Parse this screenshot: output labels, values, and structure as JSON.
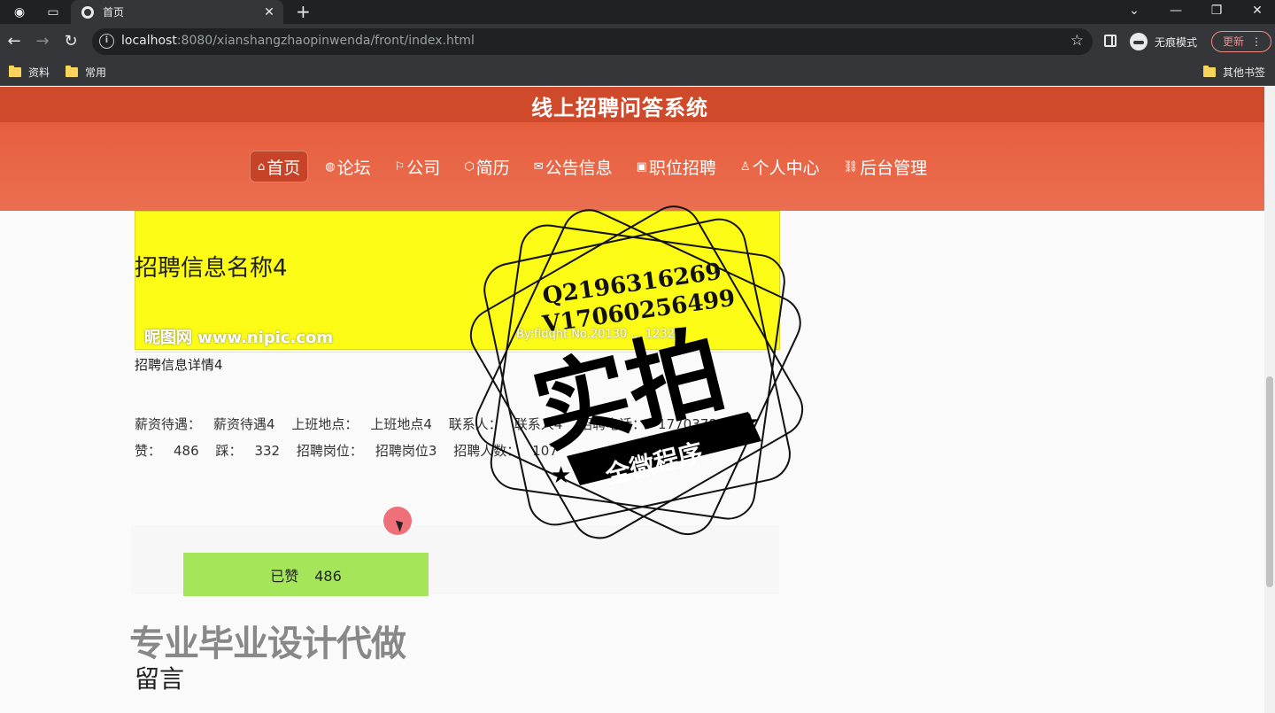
{
  "browser": {
    "tab_title": "首页",
    "url_host": "localhost",
    "url_rest": ":8080/xianshangzhaopinwenda/front/index.html",
    "incognito_label": "无痕模式",
    "update_label": "更新",
    "bookmarks": [
      "资料",
      "常用"
    ],
    "other_bookmarks": "其他书签"
  },
  "site": {
    "title": "线上招聘问答系统",
    "nav": [
      {
        "icon": "home-icon",
        "glyph": "⌂",
        "label": "首页"
      },
      {
        "icon": "globe-icon",
        "glyph": "◍",
        "label": "论坛"
      },
      {
        "icon": "flag-icon",
        "glyph": "⚐",
        "label": "公司"
      },
      {
        "icon": "cube-icon",
        "glyph": "⬡",
        "label": "简历"
      },
      {
        "icon": "mail-icon",
        "glyph": "✉",
        "label": "公告信息"
      },
      {
        "icon": "gift-icon",
        "glyph": "▣",
        "label": "职位招聘"
      },
      {
        "icon": "user-icon",
        "glyph": "♙",
        "label": "个人中心"
      },
      {
        "icon": "link-icon",
        "glyph": "⛓",
        "label": "后台管理"
      }
    ]
  },
  "banner": {
    "watermark_left": "昵图网 www.nipic.com",
    "watermark_right": "By:fldqht  No.20130 ... 12325"
  },
  "job": {
    "title": "招聘信息名称4",
    "salary_label": "薪资待遇：",
    "salary_value": "薪资待遇4",
    "location_label": "上班地点：",
    "location_value": "上班地点4",
    "contact_label": "联系人：",
    "contact_value": "联系人4",
    "phone_label": "招聘电话：",
    "phone_value": "17703786...",
    "likes_label": "赞：",
    "likes_value": "486",
    "dislikes_label": "踩：",
    "dislikes_value": "332",
    "position_label": "招聘岗位：",
    "position_value": "招聘岗位3",
    "count_label": "招聘人数：",
    "count_value": "107",
    "detail": "招聘信息详情4"
  },
  "liked_button": {
    "label": "已赞",
    "count": "486"
  },
  "overlay": {
    "ad_text": "专业毕业设计代做",
    "stamp_line1": "Q2196316269",
    "stamp_line2": "V17060256499",
    "stamp_big": "实拍",
    "stamp_ribbon": "全微程序"
  },
  "section": {
    "title": "留言"
  }
}
